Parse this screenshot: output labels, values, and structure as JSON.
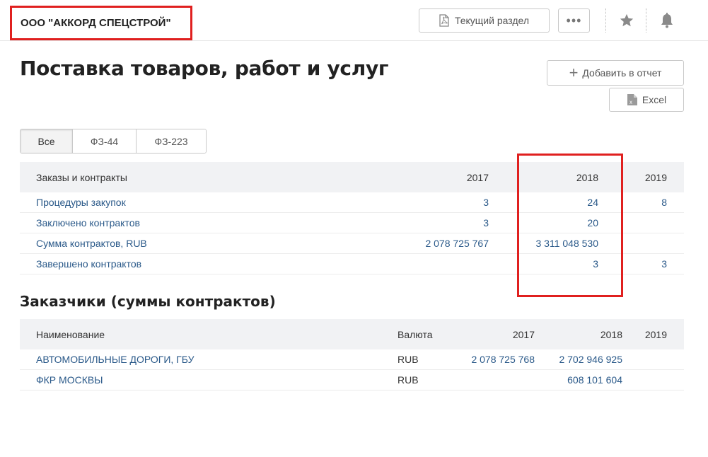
{
  "header": {
    "company_name": "ООО \"АККОРД СПЕЦСТРОЙ\"",
    "current_section_label": "Текущий раздел",
    "more_label": "•••",
    "icons": [
      "pdf-icon",
      "star-icon",
      "bell-icon"
    ]
  },
  "page": {
    "title": "Поставка товаров, работ и услуг",
    "add_to_report_label": "Добавить в отчет",
    "excel_label": "Excel"
  },
  "tabs": [
    {
      "label": "Все",
      "active": true
    },
    {
      "label": "ФЗ-44",
      "active": false
    },
    {
      "label": "ФЗ-223",
      "active": false
    }
  ],
  "orders_table": {
    "headers": {
      "name": "Заказы и контракты",
      "y2017": "2017",
      "y2018": "2018",
      "y2019": "2019"
    },
    "rows": [
      {
        "name": "Процедуры закупок",
        "y2017": "3",
        "y2018": "24",
        "y2019": "8"
      },
      {
        "name": "Заключено контрактов",
        "y2017": "3",
        "y2018": "20",
        "y2019": ""
      },
      {
        "name": "Сумма контрактов, RUB",
        "y2017": "2 078 725 767",
        "y2018": "3 311 048 530",
        "y2019": ""
      },
      {
        "name": "Завершено контрактов",
        "y2017": "",
        "y2018": "3",
        "y2019": "3"
      }
    ]
  },
  "customers": {
    "title": "Заказчики (суммы контрактов)",
    "headers": {
      "name": "Наименование",
      "currency": "Валюта",
      "y2017": "2017",
      "y2018": "2018",
      "y2019": "2019"
    },
    "rows": [
      {
        "name": "АВТОМОБИЛЬНЫЕ ДОРОГИ, ГБУ",
        "currency": "RUB",
        "y2017": "2 078 725 768",
        "y2018": "2 702 946 925",
        "y2019": ""
      },
      {
        "name": "ФКР МОСКВЫ",
        "currency": "RUB",
        "y2017": "",
        "y2018": "608 101 604",
        "y2019": ""
      }
    ]
  },
  "colors": {
    "highlight": "#e0201f",
    "link": "#2a5989",
    "header_bg": "#f1f2f4"
  }
}
